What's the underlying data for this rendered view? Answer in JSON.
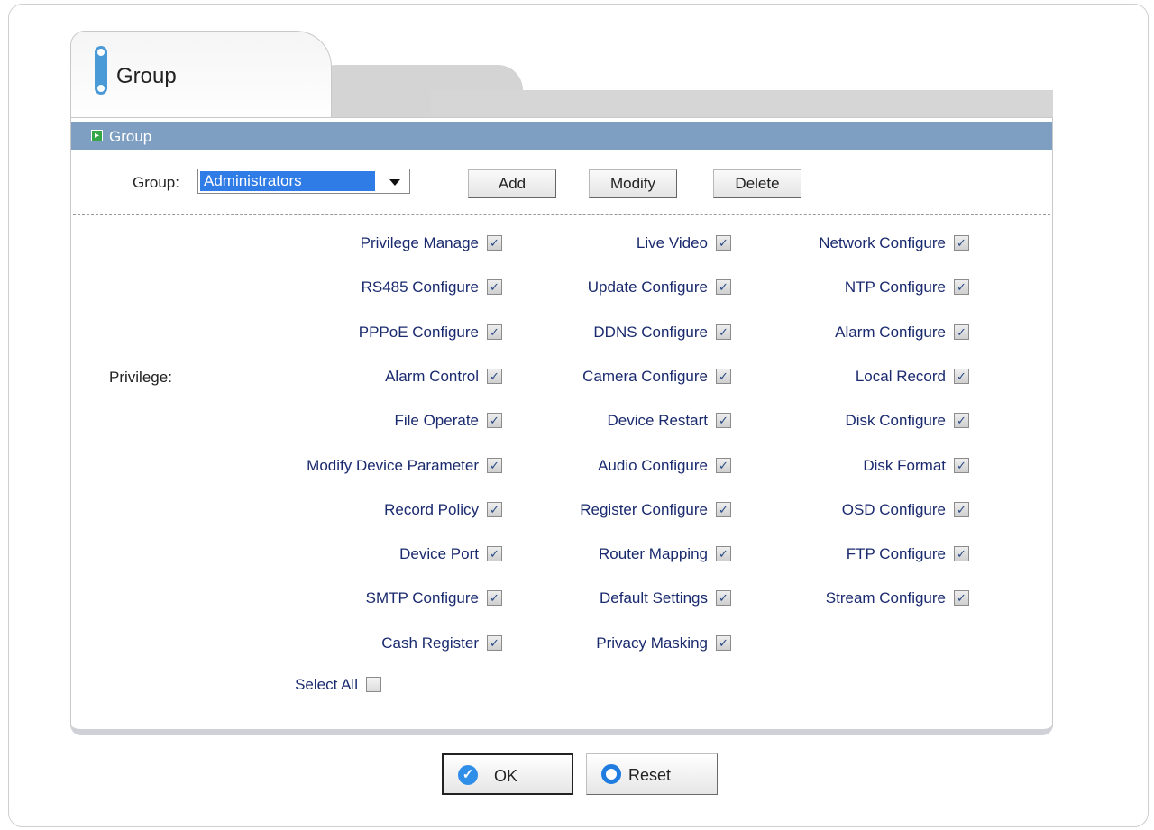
{
  "tab": {
    "title": "Group"
  },
  "panel": {
    "header": "Group"
  },
  "group_row": {
    "label": "Group:",
    "selected": "Administrators",
    "buttons": {
      "add": "Add",
      "modify": "Modify",
      "delete": "Delete"
    }
  },
  "privilege_label": "Privilege:",
  "privileges": [
    {
      "label": "Privilege Manage",
      "checked": true
    },
    {
      "label": "Live Video",
      "checked": true
    },
    {
      "label": "Network Configure",
      "checked": true
    },
    {
      "label": "RS485 Configure",
      "checked": true
    },
    {
      "label": "Update Configure",
      "checked": true
    },
    {
      "label": "NTP Configure",
      "checked": true
    },
    {
      "label": "PPPoE Configure",
      "checked": true
    },
    {
      "label": "DDNS Configure",
      "checked": true
    },
    {
      "label": "Alarm Configure",
      "checked": true
    },
    {
      "label": "Alarm Control",
      "checked": true
    },
    {
      "label": "Camera Configure",
      "checked": true
    },
    {
      "label": "Local Record",
      "checked": true
    },
    {
      "label": "File Operate",
      "checked": true
    },
    {
      "label": "Device Restart",
      "checked": true
    },
    {
      "label": "Disk Configure",
      "checked": true
    },
    {
      "label": "Modify Device Parameter",
      "checked": true
    },
    {
      "label": "Audio Configure",
      "checked": true
    },
    {
      "label": "Disk Format",
      "checked": true
    },
    {
      "label": "Record Policy",
      "checked": true
    },
    {
      "label": "Register Configure",
      "checked": true
    },
    {
      "label": "OSD Configure",
      "checked": true
    },
    {
      "label": "Device Port",
      "checked": true
    },
    {
      "label": "Router Mapping",
      "checked": true
    },
    {
      "label": "FTP Configure",
      "checked": true
    },
    {
      "label": "SMTP Configure",
      "checked": true
    },
    {
      "label": "Default Settings",
      "checked": true
    },
    {
      "label": "Stream Configure",
      "checked": true
    },
    {
      "label": "Cash Register",
      "checked": true
    },
    {
      "label": "Privacy Masking",
      "checked": true
    }
  ],
  "select_all": {
    "label": "Select All",
    "checked": false
  },
  "actions": {
    "ok": "OK",
    "reset": "Reset"
  }
}
